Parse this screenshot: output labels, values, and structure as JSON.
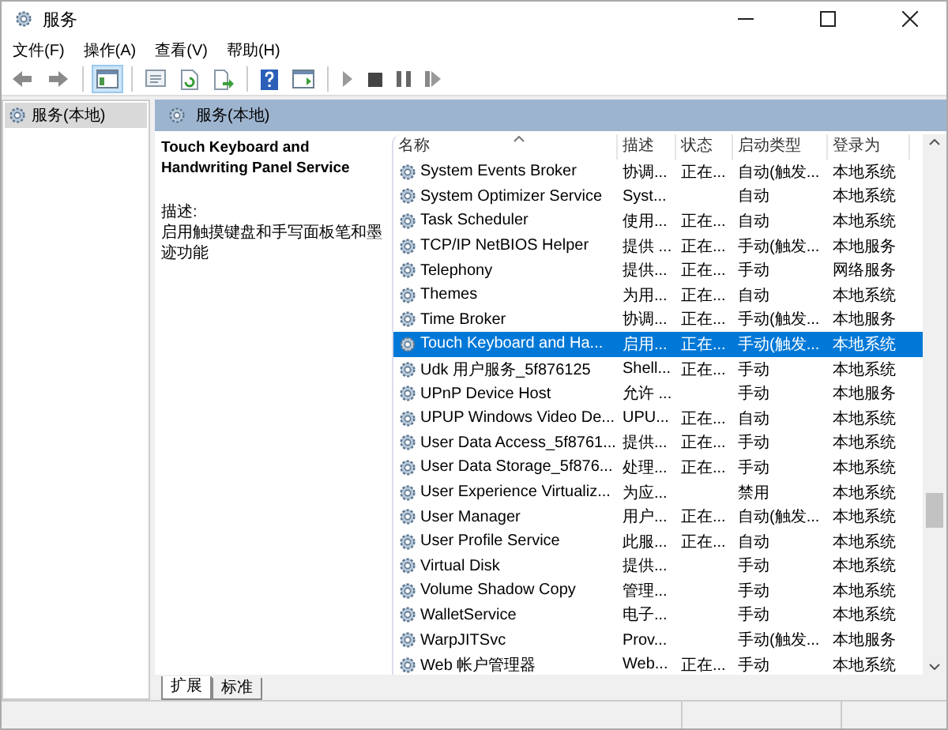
{
  "window": {
    "title": "服务"
  },
  "menu": [
    "文件(F)",
    "操作(A)",
    "查看(V)",
    "帮助(H)"
  ],
  "toolbar": [
    {
      "kind": "back",
      "pressed": false
    },
    {
      "kind": "forward",
      "pressed": false
    },
    {
      "kind": "sep",
      "pressed": false
    },
    {
      "kind": "tree",
      "pressed": true
    },
    {
      "kind": "sep",
      "pressed": false
    },
    {
      "kind": "properties",
      "pressed": false
    },
    {
      "kind": "refresh",
      "pressed": false
    },
    {
      "kind": "export",
      "pressed": false
    },
    {
      "kind": "sep",
      "pressed": false
    },
    {
      "kind": "help",
      "pressed": false
    },
    {
      "kind": "console",
      "pressed": false
    },
    {
      "kind": "sep",
      "pressed": false
    },
    {
      "kind": "play",
      "pressed": false
    },
    {
      "kind": "stop",
      "pressed": false
    },
    {
      "kind": "pause",
      "pressed": false
    },
    {
      "kind": "resume",
      "pressed": false
    }
  ],
  "tree": {
    "items": [
      {
        "label": "服务(本地)",
        "selected": true
      }
    ]
  },
  "pane": {
    "title": "服务(本地)"
  },
  "details": {
    "service_name": "Touch Keyboard and Handwriting Panel Service",
    "description_label": "描述:",
    "description": "启用触摸键盘和手写面板笔和墨迹功能"
  },
  "table": {
    "columns": [
      "名称",
      "描述",
      "状态",
      "启动类型",
      "登录为"
    ],
    "rows": [
      {
        "name": "System Events Broker",
        "description": "协调...",
        "status": "正在...",
        "startup": "自动(触发...",
        "logon": "本地系统",
        "selected": false
      },
      {
        "name": "System Optimizer Service",
        "description": "Syst...",
        "status": "",
        "startup": "自动",
        "logon": "本地系统",
        "selected": false
      },
      {
        "name": "Task Scheduler",
        "description": "使用...",
        "status": "正在...",
        "startup": "自动",
        "logon": "本地系统",
        "selected": false
      },
      {
        "name": "TCP/IP NetBIOS Helper",
        "description": "提供 ...",
        "status": "正在...",
        "startup": "手动(触发...",
        "logon": "本地服务",
        "selected": false
      },
      {
        "name": "Telephony",
        "description": "提供...",
        "status": "正在...",
        "startup": "手动",
        "logon": "网络服务",
        "selected": false
      },
      {
        "name": "Themes",
        "description": "为用...",
        "status": "正在...",
        "startup": "自动",
        "logon": "本地系统",
        "selected": false
      },
      {
        "name": "Time Broker",
        "description": "协调...",
        "status": "正在...",
        "startup": "手动(触发...",
        "logon": "本地服务",
        "selected": false
      },
      {
        "name": "Touch Keyboard and Ha...",
        "description": "启用...",
        "status": "正在...",
        "startup": "手动(触发...",
        "logon": "本地系统",
        "selected": true
      },
      {
        "name": "Udk 用户服务_5f876125",
        "description": "Shell...",
        "status": "正在...",
        "startup": "手动",
        "logon": "本地系统",
        "selected": false
      },
      {
        "name": "UPnP Device Host",
        "description": "允许 ...",
        "status": "",
        "startup": "手动",
        "logon": "本地服务",
        "selected": false
      },
      {
        "name": "UPUP Windows Video De...",
        "description": "UPU...",
        "status": "正在...",
        "startup": "自动",
        "logon": "本地系统",
        "selected": false
      },
      {
        "name": "User Data Access_5f8761...",
        "description": "提供...",
        "status": "正在...",
        "startup": "手动",
        "logon": "本地系统",
        "selected": false
      },
      {
        "name": "User Data Storage_5f876...",
        "description": "处理...",
        "status": "正在...",
        "startup": "手动",
        "logon": "本地系统",
        "selected": false
      },
      {
        "name": "User Experience Virtualiz...",
        "description": "为应...",
        "status": "",
        "startup": "禁用",
        "logon": "本地系统",
        "selected": false
      },
      {
        "name": "User Manager",
        "description": "用户...",
        "status": "正在...",
        "startup": "自动(触发...",
        "logon": "本地系统",
        "selected": false
      },
      {
        "name": "User Profile Service",
        "description": "此服...",
        "status": "正在...",
        "startup": "自动",
        "logon": "本地系统",
        "selected": false
      },
      {
        "name": "Virtual Disk",
        "description": "提供...",
        "status": "",
        "startup": "手动",
        "logon": "本地系统",
        "selected": false
      },
      {
        "name": "Volume Shadow Copy",
        "description": "管理...",
        "status": "",
        "startup": "手动",
        "logon": "本地系统",
        "selected": false
      },
      {
        "name": "WalletService",
        "description": "电子...",
        "status": "",
        "startup": "手动",
        "logon": "本地系统",
        "selected": false
      },
      {
        "name": "WarpJITSvc",
        "description": "Prov...",
        "status": "",
        "startup": "手动(触发...",
        "logon": "本地服务",
        "selected": false
      },
      {
        "name": "Web 帐户管理器",
        "description": "Web...",
        "status": "正在...",
        "startup": "手动",
        "logon": "本地系统",
        "selected": false
      }
    ]
  },
  "tabs": [
    {
      "label": "扩展",
      "selected": true
    },
    {
      "label": "标准",
      "selected": false
    }
  ]
}
